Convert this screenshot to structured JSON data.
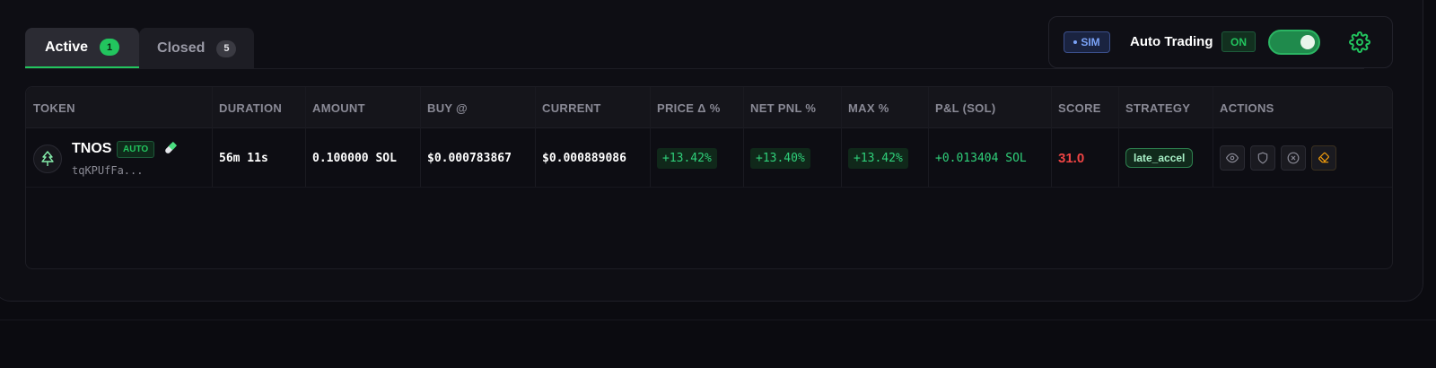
{
  "tabs": [
    {
      "label": "Active",
      "count": "1"
    },
    {
      "label": "Closed",
      "count": "5"
    }
  ],
  "controls": {
    "sim_label": "SIM",
    "auto_trading_label": "Auto Trading",
    "status_label": "ON",
    "toggle_on": true
  },
  "table": {
    "headers": [
      "TOKEN",
      "DURATION",
      "AMOUNT",
      "BUY @",
      "CURRENT",
      "PRICE Δ %",
      "NET PNL %",
      "MAX %",
      "P&L (SOL)",
      "SCORE",
      "STRATEGY",
      "ACTIONS"
    ],
    "rows": [
      {
        "token": "TNOS",
        "badge": "AUTO",
        "address": "tqKPUfFa...",
        "duration": "56m 11s",
        "amount": "0.100000 SOL",
        "buy": "$0.000783867",
        "current": "$0.000889086",
        "price_delta": "+13.42%",
        "net_pnl": "+13.40%",
        "max": "+13.42%",
        "pnl_sol": "+0.013404 SOL",
        "score": "31.0",
        "strategy": "late_accel"
      }
    ]
  },
  "icons": {
    "token": "tree-icon",
    "pill": "pill-icon",
    "settings": "gear-icon",
    "actions": [
      "eye-icon",
      "shield-icon",
      "close-circle-icon",
      "eraser-icon"
    ]
  },
  "colors": {
    "accent_green": "#22c55e",
    "score_red": "#ef4444",
    "sim_blue": "#7aa2f7",
    "eraser_orange": "#f59e0b"
  }
}
